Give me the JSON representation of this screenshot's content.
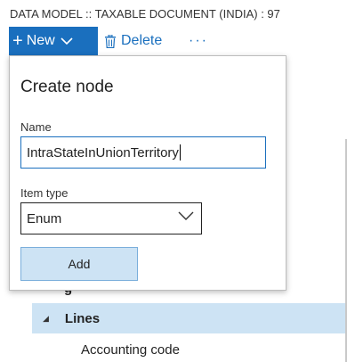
{
  "breadcrumb": "DATA MODEL :: TAXABLE DOCUMENT (INDIA) : 97",
  "toolbar": {
    "new_label": "New",
    "delete_label": "Delete",
    "more_label": "···",
    "accent_color": "#1a6fbe"
  },
  "create_node": {
    "title": "Create node",
    "name_label": "Name",
    "name_value": "IntraStateInUnionTerritory",
    "item_type_label": "Item type",
    "item_type_value": "Enum",
    "add_label": "Add"
  },
  "tree": {
    "obscured_item": "g",
    "selected_item": "Lines",
    "child_item": "Accounting code",
    "selected_color": "#cde3f4"
  }
}
